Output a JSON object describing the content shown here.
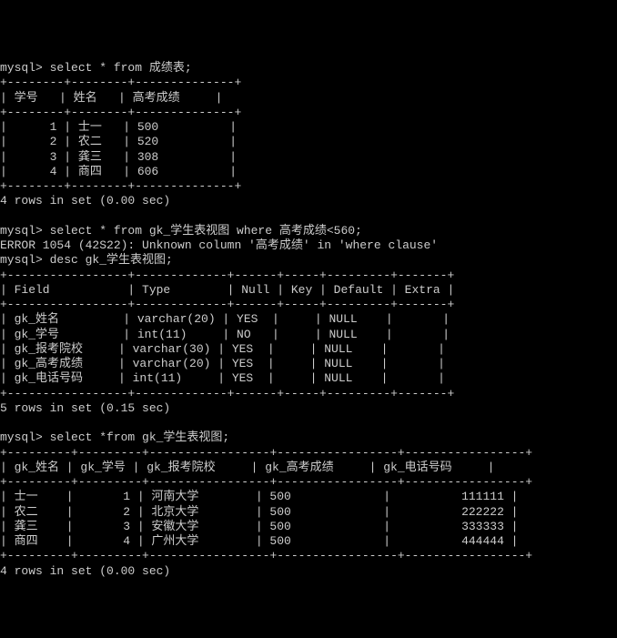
{
  "prompt": "mysql> ",
  "queries": {
    "q1": "select * from 成绩表;",
    "q2": "select * from gk_学生表视图 where 高考成绩<560;",
    "q3": "desc gk_学生表视图;",
    "q4": "select *from gk_学生表视图;"
  },
  "error": "ERROR 1054 (42S22): Unknown column '高考成绩' in 'where clause'",
  "status": {
    "s1": "4 rows in set (0.00 sec)",
    "s2": "5 rows in set (0.15 sec)",
    "s3": "4 rows in set (0.00 sec)"
  },
  "table1": {
    "border_top": "+--------+--------+--------------+",
    "header": "| 学号   | 姓名   | 高考成绩     |",
    "rows": [
      "|      1 | 士一   | 500          |",
      "|      2 | 农二   | 520          |",
      "|      3 | 龚三   | 308          |",
      "|      4 | 商四   | 606          |"
    ]
  },
  "table2": {
    "border_top": "+-----------------+-------------+------+-----+---------+-------+",
    "header": "| Field           | Type        | Null | Key | Default | Extra |",
    "rows": [
      "| gk_姓名         | varchar(20) | YES  |     | NULL    |       |",
      "| gk_学号         | int(11)     | NO   |     | NULL    |       |",
      "| gk_报考院校     | varchar(30) | YES  |     | NULL    |       |",
      "| gk_高考成绩     | varchar(20) | YES  |     | NULL    |       |",
      "| gk_电话号码     | int(11)     | YES  |     | NULL    |       |"
    ]
  },
  "table3": {
    "border_top": "+---------+---------+-----------------+-----------------+-----------------+",
    "header": "| gk_姓名 | gk_学号 | gk_报考院校     | gk_高考成绩     | gk_电话号码     |",
    "rows": [
      "| 士一    |       1 | 河南大学        | 500             |          111111 |",
      "| 农二    |       2 | 北京大学        | 500             |          222222 |",
      "| 龚三    |       3 | 安徽大学        | 500             |          333333 |",
      "| 商四    |       4 | 广州大学        | 500             |          444444 |"
    ]
  }
}
